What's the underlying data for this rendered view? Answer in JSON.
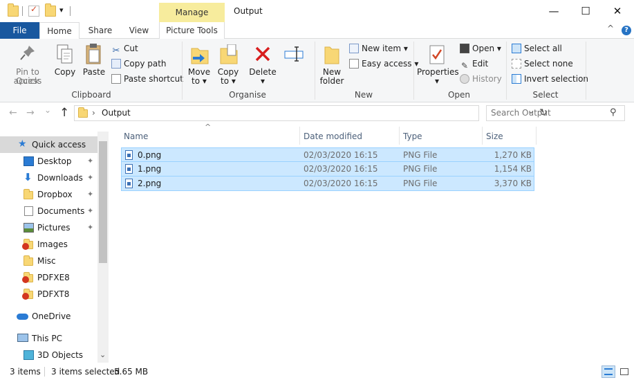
{
  "window": {
    "title": "Output",
    "manage_label": "Manage",
    "minimize_glyph": "—",
    "maximize_glyph": "☐",
    "close_glyph": "✕"
  },
  "quick_access_toolbar": {
    "customize_glyph": "▾"
  },
  "tabs": {
    "file": "File",
    "home": "Home",
    "share": "Share",
    "view": "View",
    "picture_tools": "Picture Tools",
    "help": "?",
    "collapse_glyph": "^"
  },
  "ribbon": {
    "clipboard": {
      "label": "Clipboard",
      "pin_line1": "Pin to Quick",
      "pin_line2": "access",
      "copy": "Copy",
      "paste": "Paste",
      "cut": "Cut",
      "copy_path": "Copy path",
      "paste_shortcut": "Paste shortcut"
    },
    "organise": {
      "label": "Organise",
      "move_line1": "Move",
      "move_line2": "to ▾",
      "copy_line1": "Copy",
      "copy_line2": "to ▾",
      "delete_line1": "Delete",
      "delete_line2": "▾",
      "rename": "Rename"
    },
    "new": {
      "label": "New",
      "folder_line1": "New",
      "folder_line2": "folder",
      "new_item": "New item ▾",
      "easy_access": "Easy access ▾"
    },
    "open": {
      "label": "Open",
      "properties_line1": "Properties",
      "properties_line2": "▾",
      "open": "Open ▾",
      "edit": "Edit",
      "history": "History"
    },
    "select": {
      "label": "Select",
      "select_all": "Select all",
      "select_none": "Select none",
      "invert_selection": "Invert selection"
    }
  },
  "address": {
    "back_glyph": "←",
    "forward_glyph": "→",
    "recent_glyph": "⌄",
    "up_glyph": "↑",
    "separator": "›",
    "path": "Output",
    "dropdown_glyph": "⌄",
    "refresh_glyph": "↻",
    "search_placeholder": "Search Output",
    "search_glyph": "⚲"
  },
  "nav_pane": {
    "pin_glyph": "✦",
    "items": [
      {
        "label": "Quick access"
      },
      {
        "label": "Desktop"
      },
      {
        "label": "Downloads"
      },
      {
        "label": "Dropbox"
      },
      {
        "label": "Documents"
      },
      {
        "label": "Pictures"
      },
      {
        "label": "Images"
      },
      {
        "label": "Misc"
      },
      {
        "label": "PDFXE8"
      },
      {
        "label": "PDFXT8"
      },
      {
        "label": "OneDrive"
      },
      {
        "label": "This PC"
      },
      {
        "label": "3D Objects"
      }
    ],
    "scroll_down_glyph": "⌄"
  },
  "file_list": {
    "sort_glyph": "^",
    "columns": {
      "name": "Name",
      "date_modified": "Date modified",
      "type": "Type",
      "size": "Size"
    },
    "rows": [
      {
        "name": "0.png",
        "date": "02/03/2020 16:15",
        "type": "PNG File",
        "size": "1,270 KB"
      },
      {
        "name": "1.png",
        "date": "02/03/2020 16:15",
        "type": "PNG File",
        "size": "1,154 KB"
      },
      {
        "name": "2.png",
        "date": "02/03/2020 16:15",
        "type": "PNG File",
        "size": "3,370 KB"
      }
    ]
  },
  "status_bar": {
    "item_count": "3 items",
    "selection": "3 items selected",
    "selection_size": "5.65 MB"
  }
}
